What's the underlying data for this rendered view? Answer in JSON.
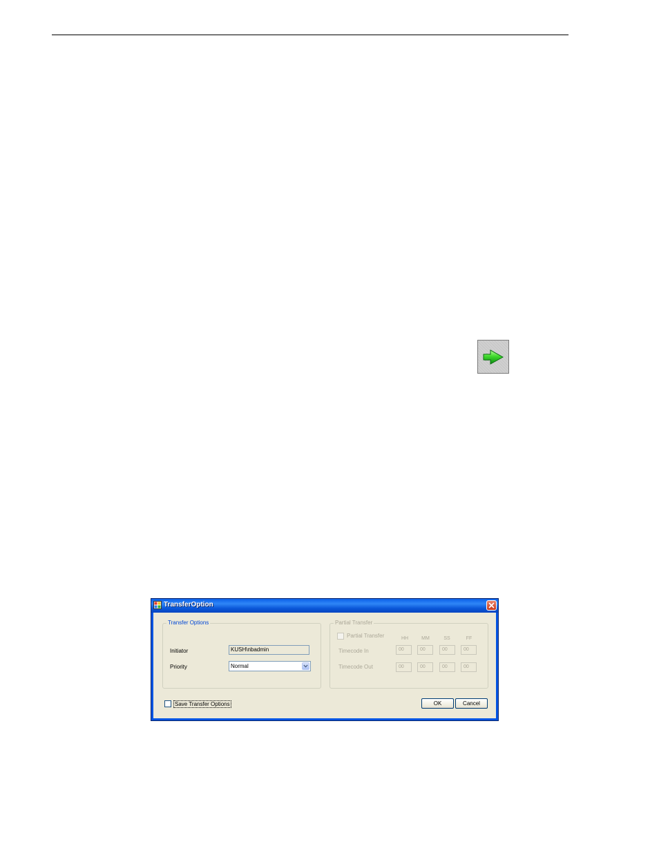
{
  "dialog": {
    "title": "TransferOption",
    "transfer_options": {
      "legend": "Transfer Options",
      "initiator_label": "Initiator",
      "initiator_value": "KUSH\\nbadmin",
      "priority_label": "Priority",
      "priority_value": "Normal"
    },
    "partial_transfer": {
      "legend": "Partial Transfer",
      "checkbox_label": "Partial Transfer",
      "headers": [
        "HH",
        "MM",
        "SS",
        "FF"
      ],
      "timecode_in_label": "Timecode In",
      "timecode_out_label": "Timecode Out",
      "timecode_in": [
        "00",
        "00",
        "00",
        "00"
      ],
      "timecode_out": [
        "00",
        "00",
        "00",
        "00"
      ]
    },
    "save_label": "Save Transfer Options",
    "ok_label": "OK",
    "cancel_label": "Cancel"
  },
  "colors": {
    "titlebar": "#0054e3",
    "dialog_background": "#ece9d8",
    "arrow_green": "#22c41c"
  },
  "icons": {
    "arrow": "right-arrow-icon",
    "close": "close-icon",
    "app": "window-app-icon",
    "dropdown": "chevron-down-icon"
  }
}
